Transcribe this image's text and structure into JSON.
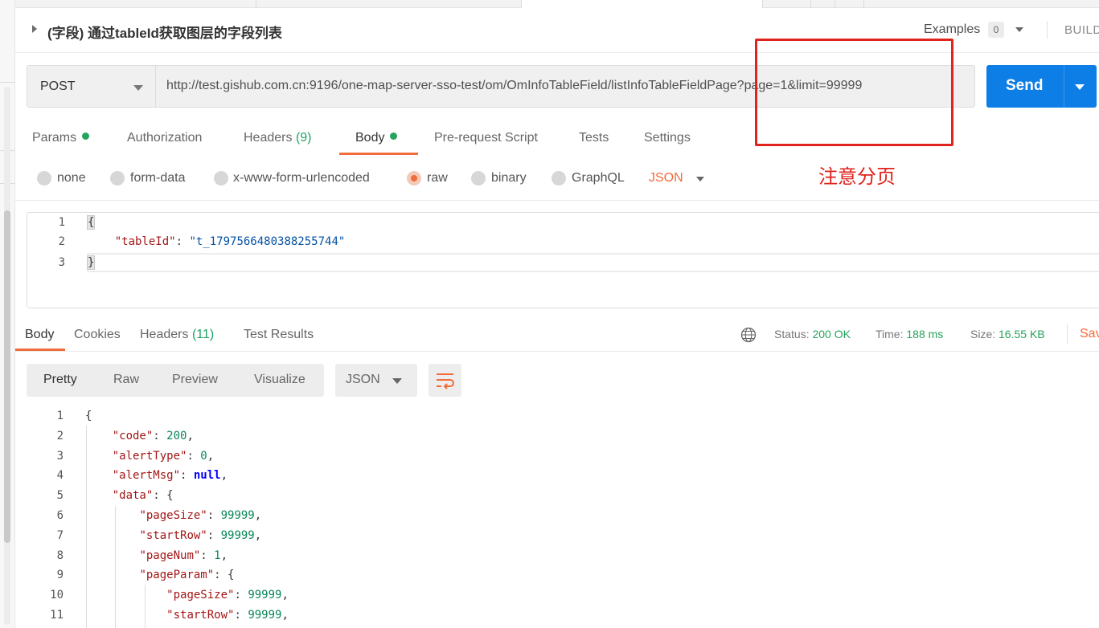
{
  "request": {
    "title": "(字段) 通过tableId获取图层的字段列表",
    "examples_label": "Examples",
    "examples_count": "0",
    "build_label": "BUILD",
    "method": "POST",
    "url": "http://test.gishub.com.cn:9196/one-map-server-sso-test/om/OmInfoTableField/listInfoTableFieldPage?page=1&limit=99999",
    "send_label": "Send"
  },
  "annotation": {
    "text": "注意分页",
    "color": "#e0231d"
  },
  "request_tabs": [
    {
      "label": "Params",
      "count": "",
      "dot": true
    },
    {
      "label": "Authorization",
      "count": "",
      "dot": false
    },
    {
      "label": "Headers",
      "count": "(9)",
      "dot": false
    },
    {
      "label": "Body",
      "count": "",
      "dot": true,
      "active": true
    },
    {
      "label": "Pre-request Script",
      "count": "",
      "dot": false
    },
    {
      "label": "Tests",
      "count": "",
      "dot": false
    },
    {
      "label": "Settings",
      "count": "",
      "dot": false
    }
  ],
  "body_types": [
    {
      "label": "none",
      "selected": false
    },
    {
      "label": "form-data",
      "selected": false
    },
    {
      "label": "x-www-form-urlencoded",
      "selected": false
    },
    {
      "label": "raw",
      "selected": true
    },
    {
      "label": "binary",
      "selected": false
    },
    {
      "label": "GraphQL",
      "selected": false
    }
  ],
  "raw_format": "JSON",
  "request_body_lines": [
    {
      "n": "1",
      "text": "{"
    },
    {
      "n": "2",
      "text": "    \"tableId\": \"t_1797566480388255744\""
    },
    {
      "n": "3",
      "text": "}"
    }
  ],
  "response_tabs": [
    {
      "label": "Body",
      "count": "",
      "active": true
    },
    {
      "label": "Cookies",
      "count": ""
    },
    {
      "label": "Headers",
      "count": "(11)"
    },
    {
      "label": "Test Results",
      "count": ""
    }
  ],
  "response_meta": {
    "status_label": "Status:",
    "status_value": "200 OK",
    "time_label": "Time:",
    "time_value": "188 ms",
    "size_label": "Size:",
    "size_value": "16.55 KB",
    "save_label": "Save"
  },
  "view_modes": [
    "Pretty",
    "Raw",
    "Preview",
    "Visualize"
  ],
  "response_format": "JSON",
  "response_lines": [
    {
      "n": "1",
      "text": "{"
    },
    {
      "n": "2",
      "text": "    \"code\": 200,"
    },
    {
      "n": "3",
      "text": "    \"alertType\": 0,"
    },
    {
      "n": "4",
      "text": "    \"alertMsg\": null,"
    },
    {
      "n": "5",
      "text": "    \"data\": {"
    },
    {
      "n": "6",
      "text": "        \"pageSize\": 99999,"
    },
    {
      "n": "7",
      "text": "        \"startRow\": 99999,"
    },
    {
      "n": "8",
      "text": "        \"pageNum\": 1,"
    },
    {
      "n": "9",
      "text": "        \"pageParam\": {"
    },
    {
      "n": "10",
      "text": "            \"pageSize\": 99999,"
    },
    {
      "n": "11",
      "text": "            \"startRow\": 99999,"
    }
  ],
  "colors": {
    "send_blue": "#0d7ee6",
    "accent_orange": "#f26b3a",
    "success_green": "#26a45b"
  }
}
